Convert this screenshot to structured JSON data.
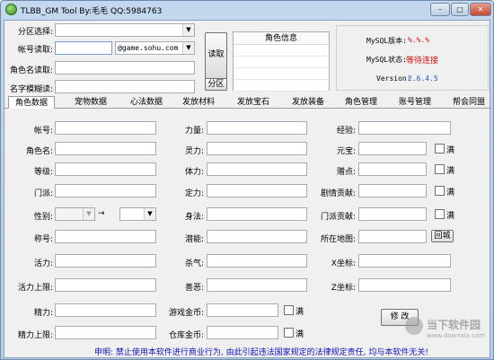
{
  "window": {
    "title": "TLBB_GM Tool By:毛毛 QQ:5984763",
    "minimize": "–",
    "maximize": "□",
    "close": "✕"
  },
  "top": {
    "server_label": "分区选择:",
    "account_label": "帐号读取:",
    "email_domain": "@game.sohu.com",
    "rolename_label": "角色名读取:",
    "fuzzy_label": "名字模糊读:",
    "read_button": "读取",
    "zone_button": "分区",
    "roleinfo_header": "角色信息",
    "mysql_version_label": "MySQL版本:",
    "mysql_version_value": "%.%.%",
    "mysql_status_label": "MySQL状态:",
    "mysql_status_value": "等待连接",
    "version_label": "Version:",
    "version_value": "2.6.4.5"
  },
  "tabs": [
    "角色数据",
    "宠物数据",
    "心法数据",
    "发放材料",
    "发放宝石",
    "发放装备",
    "角色管理",
    "账号管理",
    "帮会同盟"
  ],
  "form": {
    "col1": [
      "帐号:",
      "角色名:",
      "等级:",
      "门派:",
      "性别:",
      "称号:",
      "活力:",
      "活力上限:",
      "精力:",
      "精力上限:"
    ],
    "col2": [
      "力量:",
      "灵力:",
      "体力:",
      "定力:",
      "身法:",
      "潜能:",
      "杀气:",
      "善恶:",
      "游戏金币:",
      "仓库金币:"
    ],
    "col3": [
      "经验:",
      "元宝:",
      "赠点:",
      "剧情贡献:",
      "门派贡献:",
      "所在地图:",
      "X坐标:",
      "Z坐标:"
    ],
    "full_label": "满",
    "arrow": "→",
    "city_button": "回城",
    "modify_button": "修 改"
  },
  "footer": {
    "notice": "申明: 禁止使用本软件进行商业行为, 由此引起违法国家规定的法律规定责任, 均与本软件无关!"
  },
  "watermark": {
    "brand": "当下软件园",
    "url": "www.downxia.com"
  },
  "colors": {
    "accent_red": "#d01010",
    "accent_blue": "#1010c0",
    "version_blue": "#1a55c8"
  }
}
